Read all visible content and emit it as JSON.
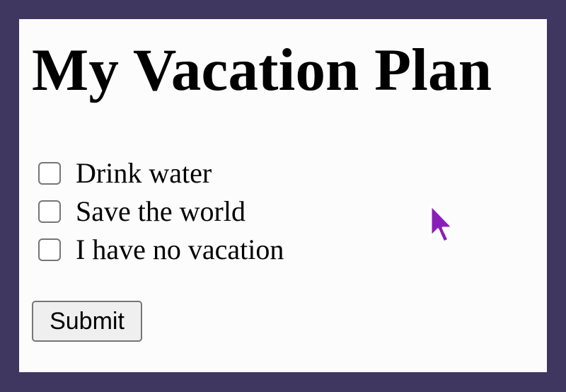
{
  "page": {
    "title": "My Vacation Plan",
    "background_color": "#3f3760",
    "panel_color": "#fcfcfc"
  },
  "checklist": {
    "items": [
      {
        "label": "Drink water",
        "checked": false
      },
      {
        "label": "Save the world",
        "checked": false
      },
      {
        "label": "I have no vacation",
        "checked": false
      }
    ]
  },
  "form": {
    "submit_label": "Submit"
  },
  "cursor": {
    "icon": "pointer-arrow-icon",
    "color": "#8a1fb8"
  }
}
